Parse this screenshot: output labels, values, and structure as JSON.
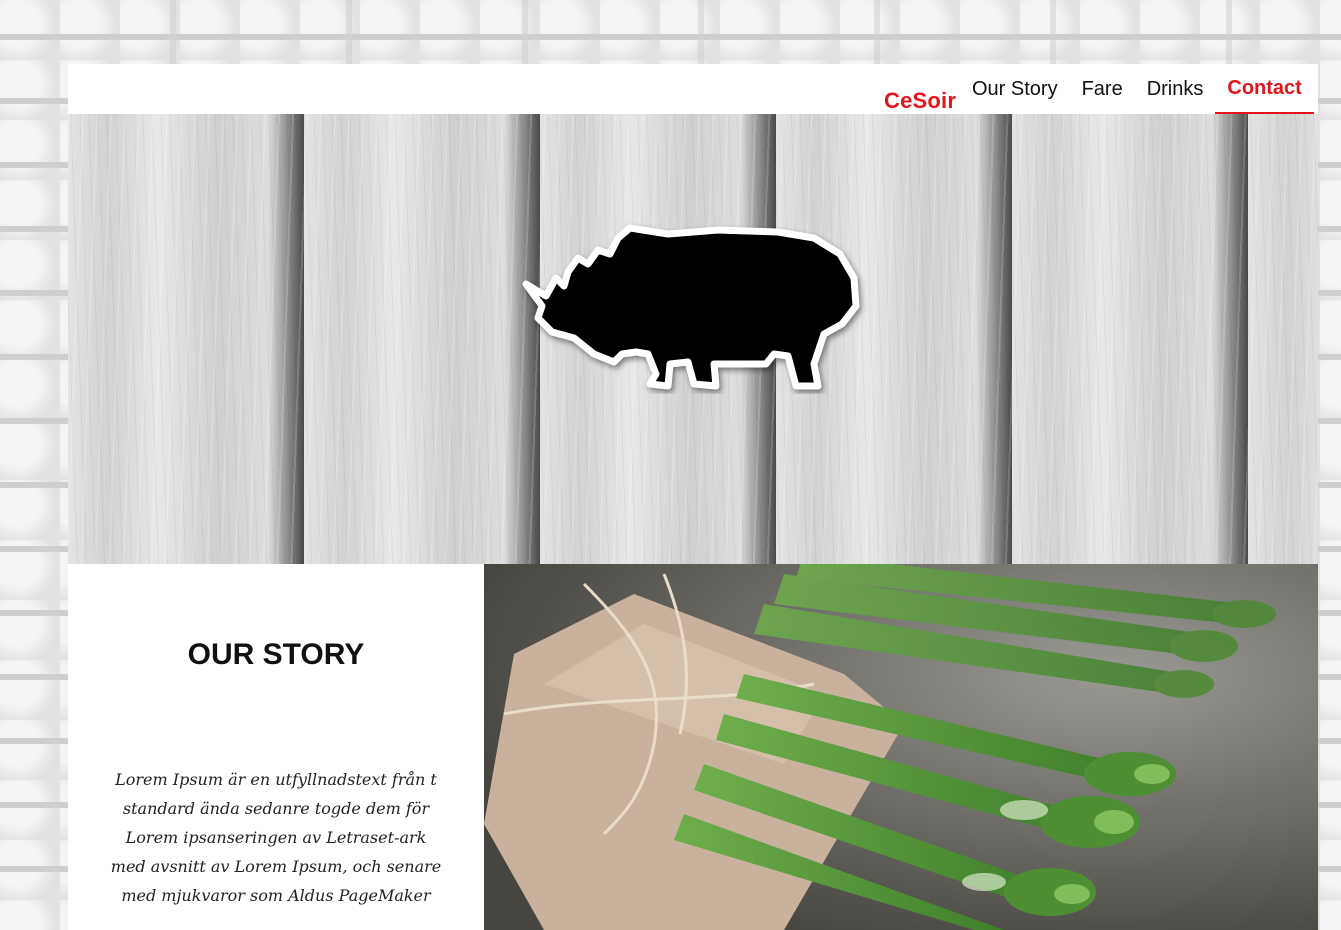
{
  "header": {
    "brand": "CeSoir",
    "nav": [
      {
        "label": "Our Story"
      },
      {
        "label": "Fare"
      },
      {
        "label": "Drinks"
      },
      {
        "label": "Contact",
        "active": true
      }
    ]
  },
  "hero": {
    "logo_icon": "rhino-silhouette-icon"
  },
  "story": {
    "title": "OUR STORY",
    "body": "Lorem Ipsum är en utfyllnadstext från t standard ända sedanre togde dem för Lorem ipsanseringen av Letraset-ark med avsnitt av Lorem Ipsum, och senare med mjukvaror som Aldus PageMaker",
    "image_icon": "asparagus-photo"
  },
  "colors": {
    "accent": "#e2141c",
    "text": "#111111",
    "background": "#ffffff"
  }
}
